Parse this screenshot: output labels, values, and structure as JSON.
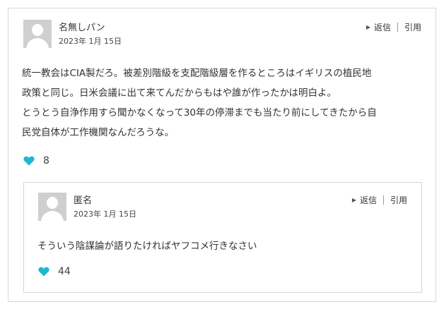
{
  "outer_comment": {
    "author": "名無しパン",
    "date": "2023年 1月 15日",
    "reply_label": "返信",
    "quote_label": "引用",
    "text_lines": [
      "統一教会はCIA製だろ。被差別階級を支配階級層を作るところはイギリスの植民地",
      "政策と同じ。日米会議に出て来てんだからもはや誰が作ったかは明白よ。",
      "とうとう自浄作用すら聞かなくなって30年の停滞までも当たり前にしてきたから自",
      "民党自体が工作機関なんだろうな。"
    ],
    "like_count": "8"
  },
  "reply_comment": {
    "author": "匿名",
    "date": "2023年 1月 15日",
    "reply_label": "返信",
    "quote_label": "引用",
    "text": "そういう陰謀論が語りたければヤフコメ行きなさい",
    "like_count": "44"
  },
  "colors": {
    "heart": "#1fb8cf",
    "border": "#d6d6d6",
    "avatar_bg": "#cfcfcf"
  },
  "icons": [
    "avatar-icon",
    "reply-arrow-icon",
    "heart-icon"
  ]
}
